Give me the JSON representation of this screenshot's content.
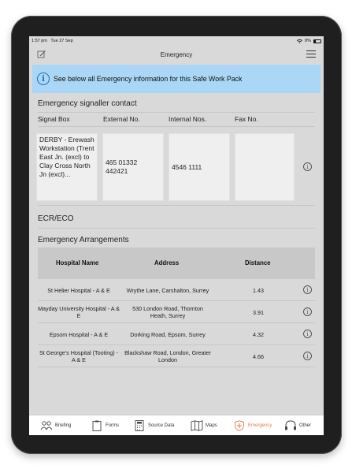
{
  "status": {
    "time": "1:57 pm",
    "date": "Tue 27 Sep",
    "battery": "8%"
  },
  "nav": {
    "title": "Emergency"
  },
  "banner": {
    "text": "See below all Emergency information for this Safe Work Pack"
  },
  "signaller": {
    "title": "Emergency signaller contact",
    "headers": [
      "Signal Box",
      "External No.",
      "Internal Nos.",
      "Fax No."
    ],
    "signal_box": "DERBY - Erewash Workstation (Trent East Jn. (excl) to Clay Cross North Jn (excl)...",
    "external_no": "465 01332 442421",
    "internal_no": "4546 1111",
    "fax_no": ""
  },
  "ecr": {
    "title": "ECR/ECO"
  },
  "arrangements": {
    "title": "Emergency Arrangements",
    "headers": [
      "Hospital Name",
      "Address",
      "Distance"
    ],
    "rows": [
      {
        "name": "St Helier Hospital - A & E",
        "address": "Wrythe Lane, Carshalton, Surrey",
        "distance": "1.43"
      },
      {
        "name": "Mayday University Hospital - A & E",
        "address": "530 London Road, Thornton Heath, Surrey",
        "distance": "3.91"
      },
      {
        "name": "Epsom Hospital - A & E",
        "address": "Dorking Road, Epsom, Surrey",
        "distance": "4.32"
      },
      {
        "name": "St George's Hospital (Tooting) - A & E",
        "address": "Blackshaw Road, London, Greater London",
        "distance": "4.66"
      }
    ]
  },
  "tabs": [
    {
      "label": "Briefing",
      "icon": "people-icon"
    },
    {
      "label": "Forms",
      "icon": "clipboard-icon"
    },
    {
      "label": "Source Data",
      "icon": "calculator-icon"
    },
    {
      "label": "Maps",
      "icon": "map-icon"
    },
    {
      "label": "Emergency",
      "icon": "shield-cross-icon",
      "active": true
    },
    {
      "label": "Other",
      "icon": "headset-icon"
    }
  ],
  "colors": {
    "accent": "#e8784a",
    "banner": "#a9d7f5",
    "info": "#1a6fb5"
  }
}
